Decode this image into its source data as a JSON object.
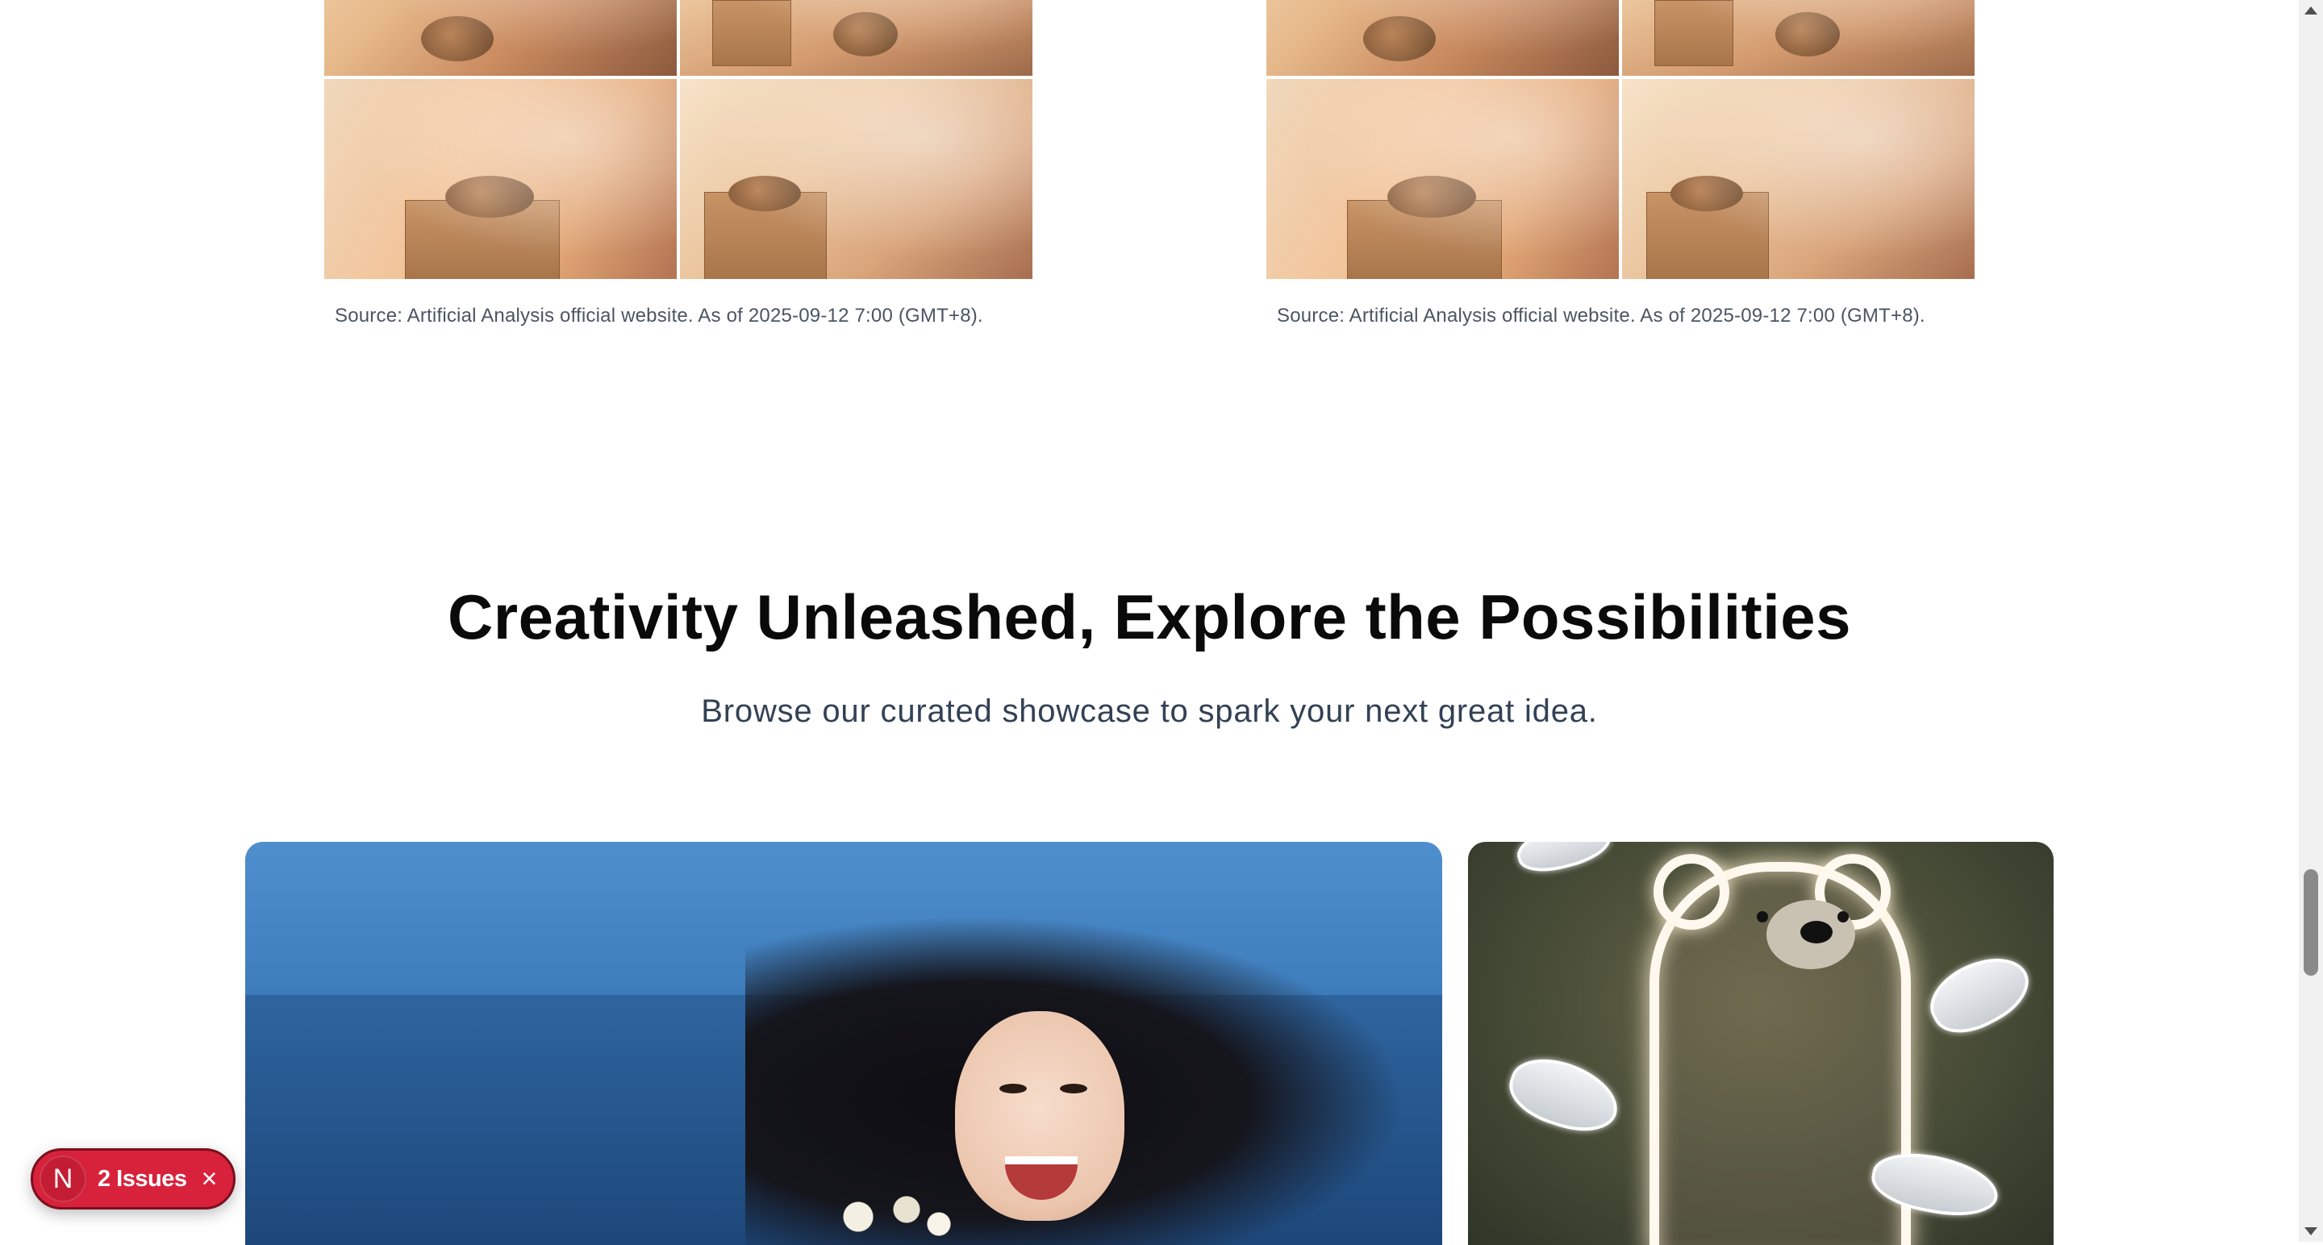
{
  "comparisons": [
    {
      "caption": "Source: Artificial Analysis official website. As of 2025-09-12 7:00 (GMT+8)."
    },
    {
      "caption": "Source: Artificial Analysis official website. As of 2025-09-12 7:00 (GMT+8)."
    }
  ],
  "showcase": {
    "heading": "Creativity Unleashed, Explore the Possibilities",
    "subheading": "Browse our curated showcase to spark your next great idea."
  },
  "issues_badge": {
    "logo_letter": "N",
    "label": "2 Issues",
    "close_icon": "×"
  },
  "icons": [
    "scroll-up-arrow-icon",
    "scroll-down-arrow-icon",
    "close-icon"
  ]
}
